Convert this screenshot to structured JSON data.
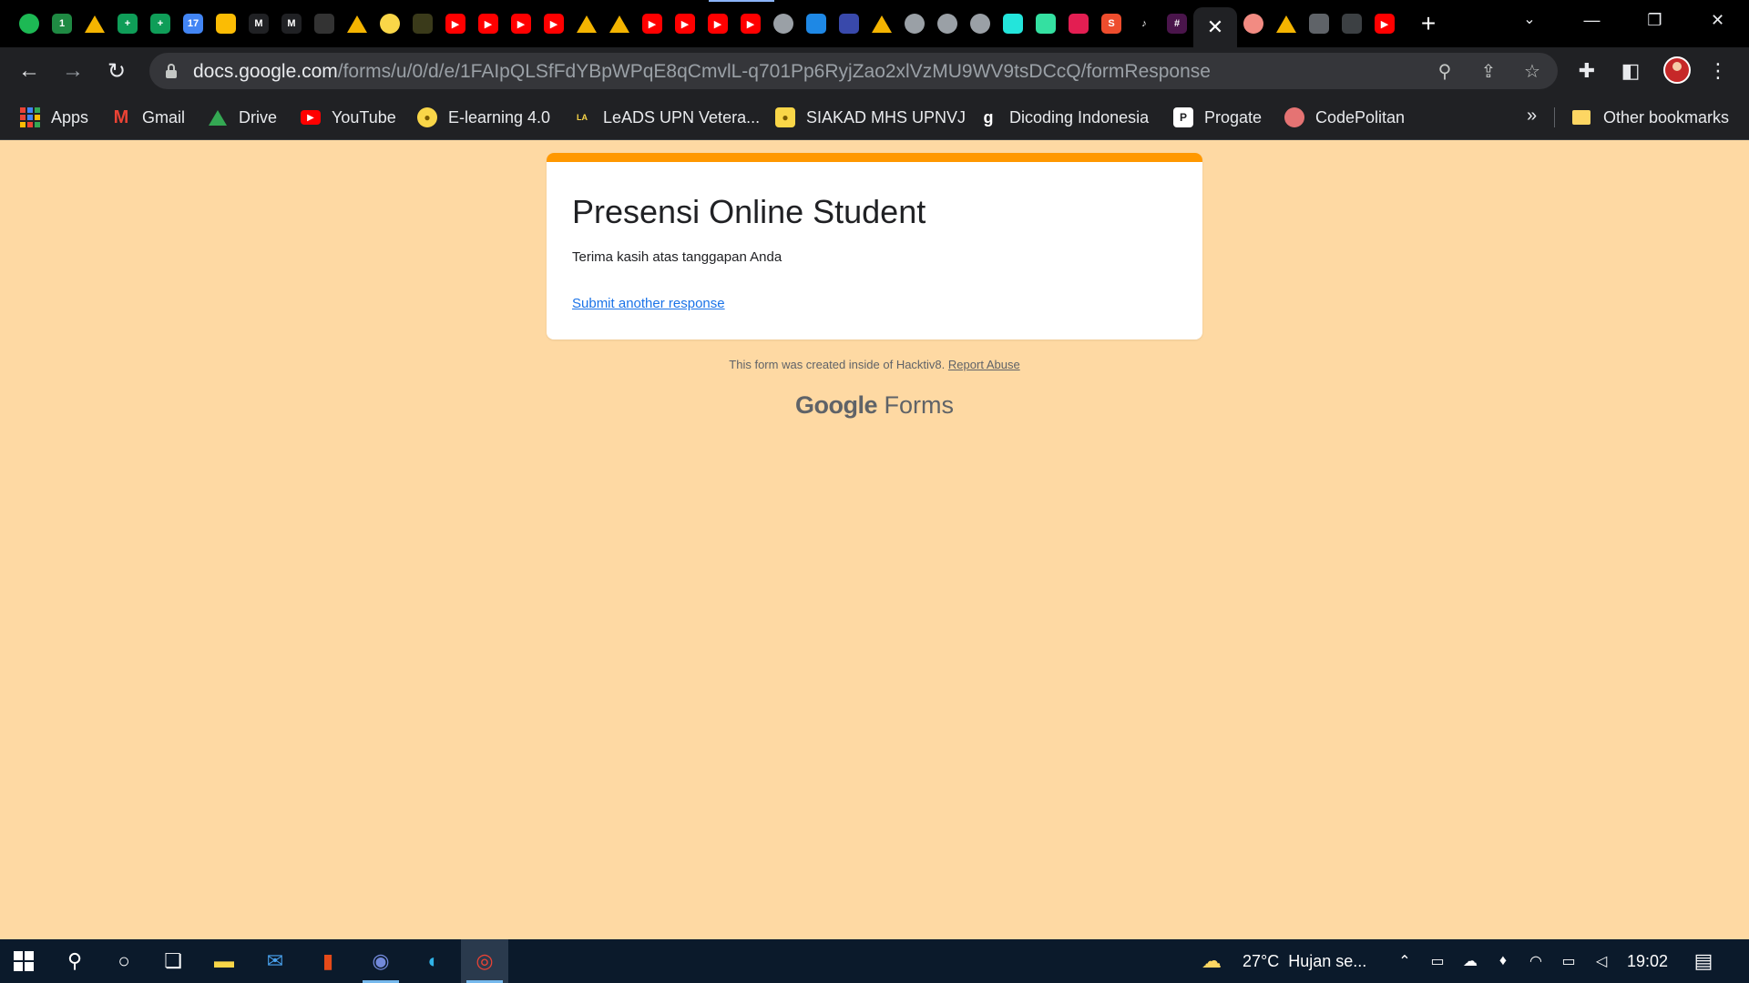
{
  "browser": {
    "tab_close_glyph": "✕",
    "new_tab_glyph": "+",
    "tab_favicons": [
      {
        "icon": "spotify-icon",
        "label": "",
        "color": "#1db954"
      },
      {
        "icon": "one-icon",
        "label": "1",
        "color": "#1f8a43"
      },
      {
        "icon": "drive-icon",
        "label": "",
        "color": "#f4b400"
      },
      {
        "icon": "sheets-plus-icon",
        "label": "+",
        "color": "#0f9d58"
      },
      {
        "icon": "sheets-plus-icon",
        "label": "+",
        "color": "#0f9d58"
      },
      {
        "icon": "calendar-icon",
        "label": "17",
        "color": "#4285f4"
      },
      {
        "icon": "keep-icon",
        "label": "",
        "color": "#fbbc04"
      },
      {
        "icon": "gmail-icon",
        "label": "M",
        "color": "#202124"
      },
      {
        "icon": "gmail-icon",
        "label": "M",
        "color": "#202124"
      },
      {
        "icon": "dark-site-icon",
        "label": "",
        "color": "#333333"
      },
      {
        "icon": "drive-icon",
        "label": "",
        "color": "#f4b400"
      },
      {
        "icon": "upnvj-icon",
        "label": "",
        "color": "#f9d648"
      },
      {
        "icon": "leads-icon",
        "label": "",
        "color": "#3a3a1a"
      },
      {
        "icon": "youtube-icon",
        "label": "▶",
        "color": "#ff0000"
      },
      {
        "icon": "youtube-icon",
        "label": "▶",
        "color": "#ff0000"
      },
      {
        "icon": "youtube-icon",
        "label": "▶",
        "color": "#ff0000"
      },
      {
        "icon": "youtube-icon",
        "label": "▶",
        "color": "#ff0000"
      },
      {
        "icon": "drive-icon",
        "label": "",
        "color": "#f4b400"
      },
      {
        "icon": "drive-icon",
        "label": "",
        "color": "#f4b400"
      },
      {
        "icon": "youtube-icon",
        "label": "▶",
        "color": "#ff0000"
      },
      {
        "icon": "youtube-icon",
        "label": "▶",
        "color": "#ff0000"
      },
      {
        "icon": "youtube-icon",
        "label": "▶",
        "color": "#ff0000"
      },
      {
        "icon": "youtube-icon",
        "label": "▶",
        "color": "#ff0000"
      },
      {
        "icon": "globe-icon",
        "label": "",
        "color": "#9aa0a6"
      },
      {
        "icon": "dp-icon",
        "label": "",
        "color": "#1e88e5"
      },
      {
        "icon": "banner-icon",
        "label": "",
        "color": "#3949ab"
      },
      {
        "icon": "drive-icon",
        "label": "",
        "color": "#f4b400"
      },
      {
        "icon": "globe-icon",
        "label": "",
        "color": "#9aa0a6"
      },
      {
        "icon": "globe-icon",
        "label": "",
        "color": "#9aa0a6"
      },
      {
        "icon": "globe-icon",
        "label": "",
        "color": "#9aa0a6"
      },
      {
        "icon": "olx-icon",
        "label": "",
        "color": "#23e5db"
      },
      {
        "icon": "tripadvisor-icon",
        "label": "",
        "color": "#34e0a1"
      },
      {
        "icon": "bukalapak-icon",
        "label": "",
        "color": "#e31e52"
      },
      {
        "icon": "shopee-icon",
        "label": "S",
        "color": "#ee4d2d"
      },
      {
        "icon": "tiktok-icon",
        "label": "♪",
        "color": "#000000"
      },
      {
        "icon": "slack-icon",
        "label": "#",
        "color": "#4a154b"
      }
    ],
    "tab_favicons_after": [
      {
        "icon": "record-icon",
        "label": "",
        "color": "#f28b82"
      },
      {
        "icon": "drive-icon",
        "label": "",
        "color": "#f4b400"
      },
      {
        "icon": "contacts-icon",
        "label": "",
        "color": "#5f6368"
      },
      {
        "icon": "compass-icon",
        "label": "",
        "color": "#3c4043"
      },
      {
        "icon": "youtube-icon",
        "label": "▶",
        "color": "#ff0000"
      }
    ],
    "url_host": "docs.google.com",
    "url_path": "/forms/u/0/d/e/1FAIpQLSfFdYBpWPqE8qCmvlL-q701Pp6RyjZao2xlVzMU9WV9tsDCcQ/formResponse",
    "bookmarks": [
      {
        "label": "Apps",
        "icon": "apps-grid-icon"
      },
      {
        "label": "Gmail",
        "icon": "gmail-icon"
      },
      {
        "label": "Drive",
        "icon": "drive-icon"
      },
      {
        "label": "YouTube",
        "icon": "youtube-icon"
      },
      {
        "label": "E-learning 4.0",
        "icon": "upnvj-icon"
      },
      {
        "label": "LeADS UPN Vetera...",
        "icon": "leads-icon"
      },
      {
        "label": "SIAKAD MHS UPNVJ",
        "icon": "upnvj-icon"
      },
      {
        "label": "Dicoding Indonesia",
        "icon": "dicoding-icon"
      },
      {
        "label": "Progate",
        "icon": "progate-icon"
      },
      {
        "label": "CodePolitan",
        "icon": "codepolitan-icon"
      }
    ],
    "bookmarks_overflow": "»",
    "other_bookmarks": "Other bookmarks"
  },
  "form": {
    "accent_color": "#ff9800",
    "title": "Presensi Online Student",
    "message": "Terima kasih atas tanggapan Anda",
    "submit_another": "Submit another response",
    "footer_text": "This form was created inside of Hacktiv8.",
    "report_abuse": "Report Abuse",
    "brand_google": "Google",
    "brand_forms": "Forms"
  },
  "taskbar": {
    "weather_temp": "27°C",
    "weather_text": "Hujan se...",
    "clock": "19:02"
  }
}
